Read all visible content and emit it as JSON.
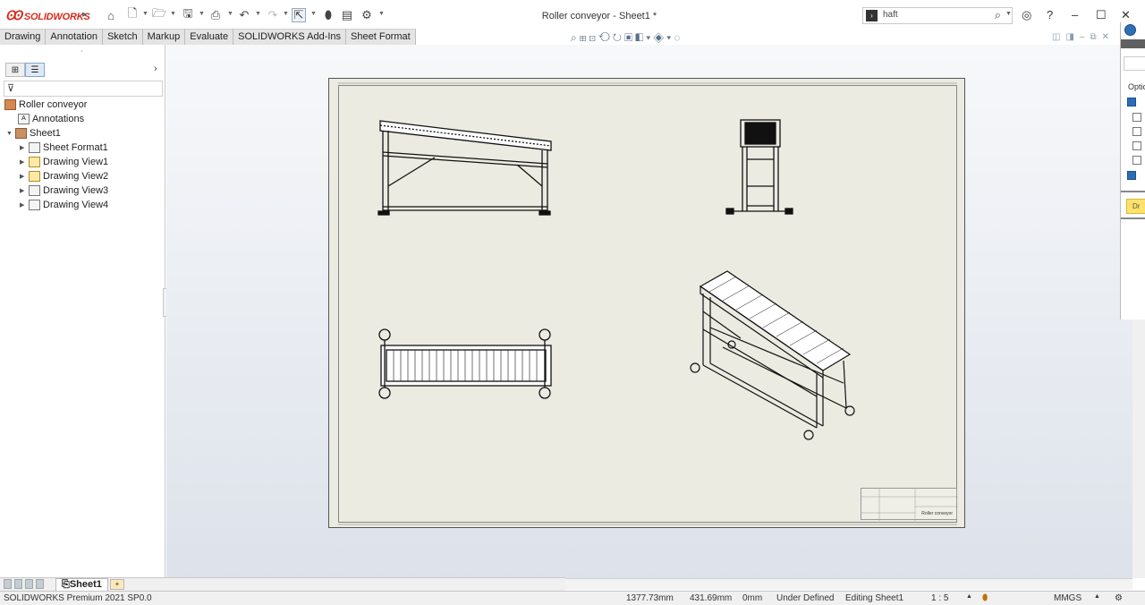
{
  "app": {
    "brand": "SOLIDWORKS",
    "document_title": "Roller conveyor - Sheet1 *"
  },
  "search": {
    "value": "haft"
  },
  "command_tabs": [
    "Drawing",
    "Annotation",
    "Sketch",
    "Markup",
    "Evaluate",
    "SOLIDWORKS Add-Ins",
    "Sheet Format"
  ],
  "feature_tree": {
    "root": "Roller conveyor",
    "annotations": "Annotations",
    "sheet": "Sheet1",
    "items": [
      "Sheet Format1",
      "Drawing View1",
      "Drawing View2",
      "Drawing View3",
      "Drawing View4"
    ]
  },
  "drawing": {
    "title_block_text": "Roller conveyor"
  },
  "task_pane": {
    "options_label": "Optio",
    "yellow_button": "Dr"
  },
  "sheet_tabs": {
    "active": "Sheet1"
  },
  "status_bar": {
    "product": "SOLIDWORKS Premium 2021 SP0.0",
    "x": "1377.73mm",
    "y": "431.69mm",
    "z": "0mm",
    "state": "Under Defined",
    "editing": "Editing Sheet1",
    "scale": "1 : 5",
    "units": "MMGS"
  },
  "colors": {
    "brand": "#d52b1e",
    "sheet": "#ebebe2",
    "accent": "#2d6cb5"
  }
}
